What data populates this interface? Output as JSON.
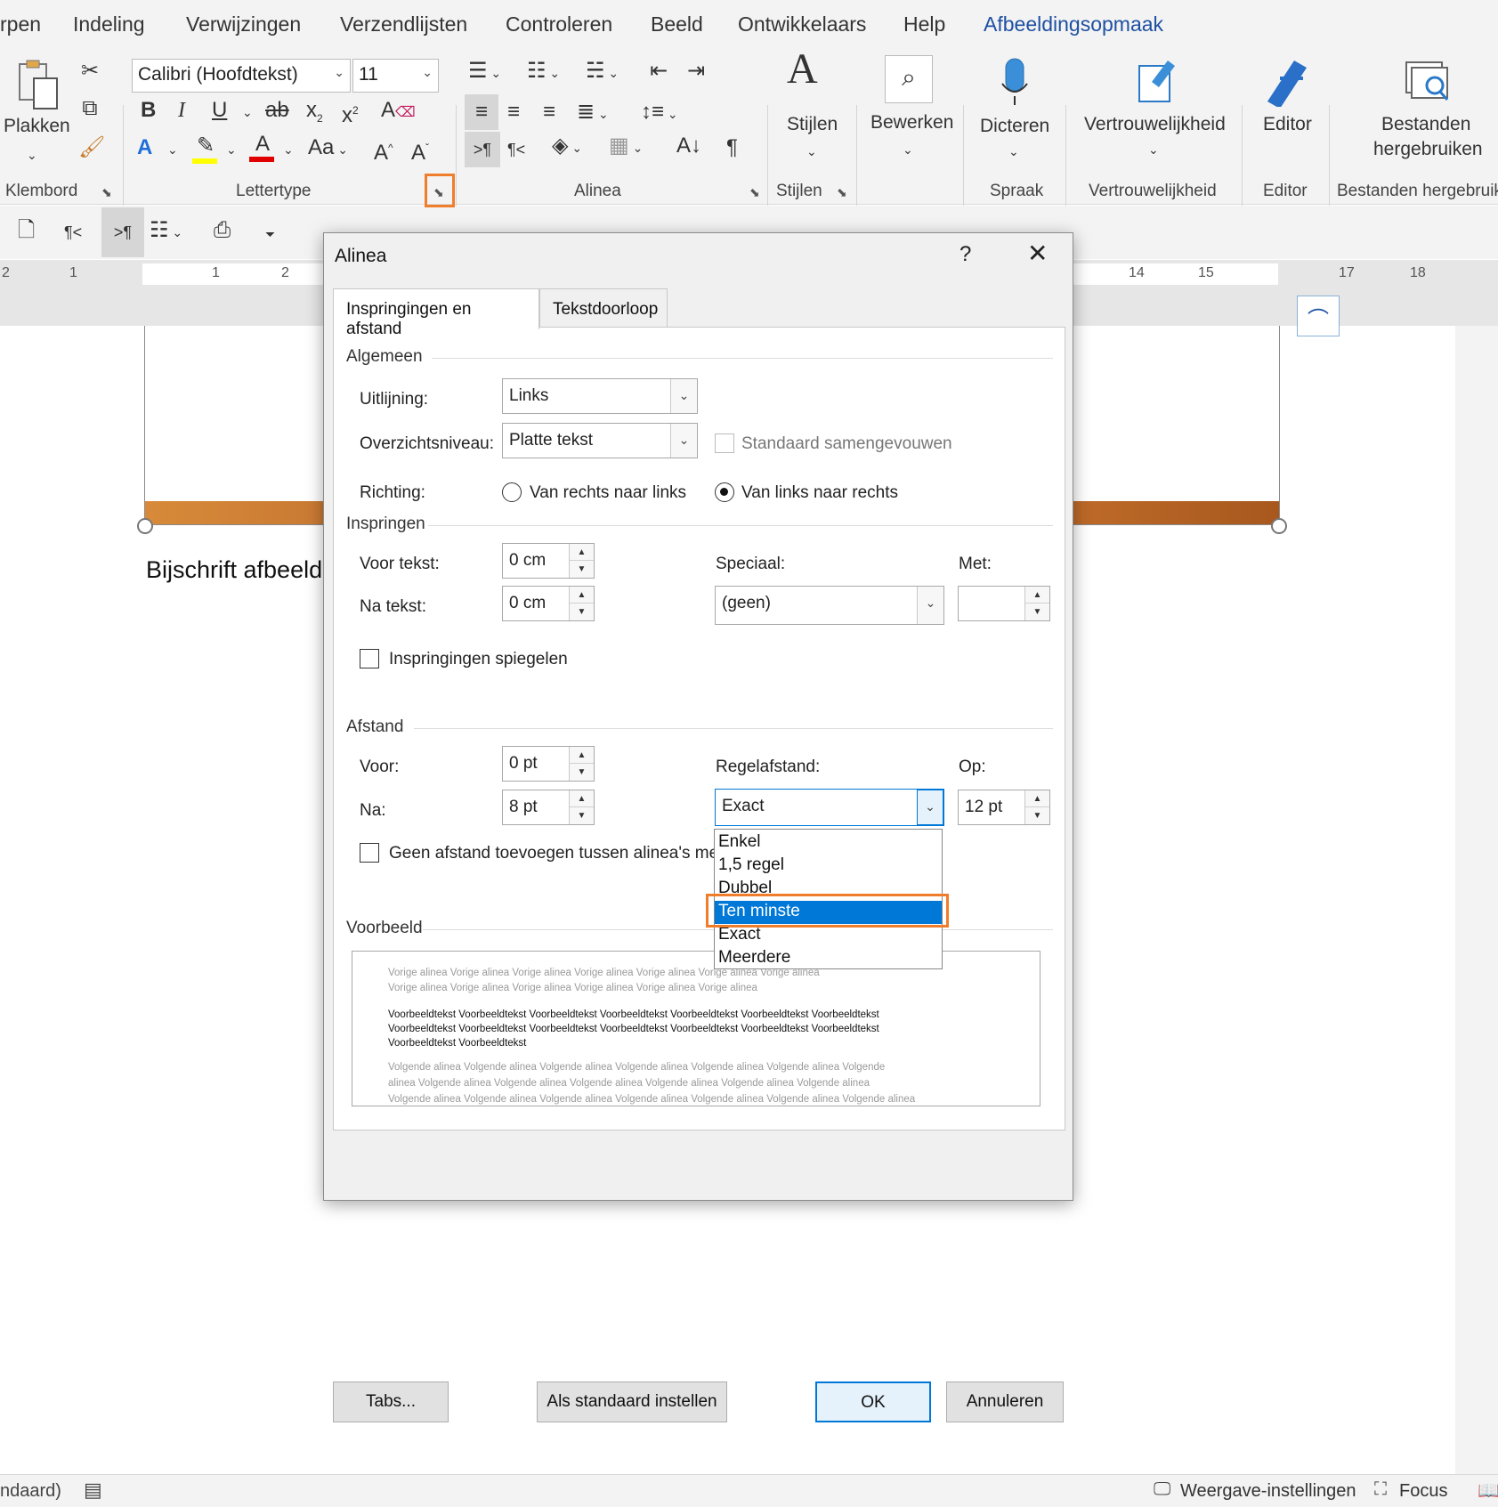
{
  "menu": {
    "tabs": [
      "rpen",
      "Indeling",
      "Verwijzingen",
      "Verzendlijsten",
      "Controleren",
      "Beeld",
      "Ontwikkelaars",
      "Help",
      "Afbeeldingsopmaak"
    ]
  },
  "ribbon": {
    "clipboard": {
      "paste_label": "Plakken",
      "group_label": "Klembord"
    },
    "font": {
      "font_name": "Calibri (Hoofdtekst)",
      "font_size": "11",
      "group_label": "Lettertype",
      "case_label": "Aa"
    },
    "paragraph": {
      "group_label": "Alinea"
    },
    "styles": {
      "label": "Stijlen",
      "group_label": "Stijlen"
    },
    "editing": {
      "label": "Bewerken"
    },
    "voice": {
      "label": "Dicteren",
      "group_label": "Spraak"
    },
    "sensitivity": {
      "label": "Vertrouwelijkheid",
      "group_label": "Vertrouwelijkheid"
    },
    "editor": {
      "label": "Editor",
      "group_label": "Editor"
    },
    "reuse": {
      "label_line1": "Bestanden",
      "label_line2": "hergebruiken",
      "group_label": "Bestanden hergebruik"
    }
  },
  "ruler": {
    "numbers": [
      "2",
      "1",
      "1",
      "2",
      "14",
      "15",
      "17",
      "18"
    ]
  },
  "document": {
    "caption_text": "Bijschrift afbeeld"
  },
  "dialog": {
    "title": "Alinea",
    "help": "?",
    "tabs": [
      "Inspringingen en afstand",
      "Tekstdoorloop"
    ],
    "general": {
      "section": "Algemeen",
      "alignment_label": "Uitlijning:",
      "alignment_value": "Links",
      "outline_label": "Overzichtsniveau:",
      "outline_value": "Platte tekst",
      "collapsed_label": "Standaard samengevouwen",
      "direction_label": "Richting:",
      "rtl_label": "Van rechts naar links",
      "ltr_label": "Van links naar rechts"
    },
    "indent": {
      "section": "Inspringen",
      "before_label": "Voor tekst:",
      "before_value": "0 cm",
      "after_label": "Na tekst:",
      "after_value": "0 cm",
      "special_label": "Speciaal:",
      "special_value": "(geen)",
      "by_label": "Met:",
      "by_value": "",
      "mirror_label": "Inspringingen spiegelen"
    },
    "spacing": {
      "section": "Afstand",
      "before_label": "Voor:",
      "before_value": "0 pt",
      "after_label": "Na:",
      "after_value": "8 pt",
      "line_label": "Regelafstand:",
      "line_value": "Exact",
      "at_label": "Op:",
      "at_value": "12 pt",
      "no_space_label": "Geen afstand toevoegen tussen alinea's met d",
      "line_options": [
        "Enkel",
        "1,5 regel",
        "Dubbel",
        "Ten minste",
        "Exact",
        "Meerdere"
      ],
      "highlighted_option": "Ten minste"
    },
    "preview": {
      "section": "Voorbeeld",
      "prev1": "Vorige alinea Vorige alinea Vorige alinea Vorige alinea Vorige alinea Vorige alinea Vorige alinea",
      "prev2": "Vorige alinea Vorige alinea Vorige alinea Vorige alinea Vorige alinea Vorige alinea",
      "sample1": "Voorbeeldtekst Voorbeeldtekst Voorbeeldtekst Voorbeeldtekst Voorbeeldtekst Voorbeeldtekst Voorbeeldtekst",
      "sample2": "Voorbeeldtekst Voorbeeldtekst Voorbeeldtekst Voorbeeldtekst Voorbeeldtekst Voorbeeldtekst Voorbeeldtekst",
      "sample3": "Voorbeeldtekst Voorbeeldtekst",
      "next1": "Volgende alinea Volgende alinea Volgende alinea Volgende alinea Volgende alinea Volgende alinea Volgende",
      "next2": "alinea Volgende alinea Volgende alinea Volgende alinea Volgende alinea Volgende alinea Volgende alinea",
      "next3": "Volgende alinea Volgende alinea Volgende alinea Volgende alinea Volgende alinea Volgende alinea Volgende alinea"
    },
    "buttons": {
      "tabs": "Tabs...",
      "default": "Als standaard instellen",
      "ok": "OK",
      "cancel": "Annuleren"
    }
  },
  "status": {
    "left": "ndaard)",
    "view_settings": "Weergave-instellingen",
    "focus": "Focus"
  },
  "colors": {
    "accent": "#1e50a2",
    "selection": "#0078d7",
    "highlight": "#f07d2b"
  }
}
